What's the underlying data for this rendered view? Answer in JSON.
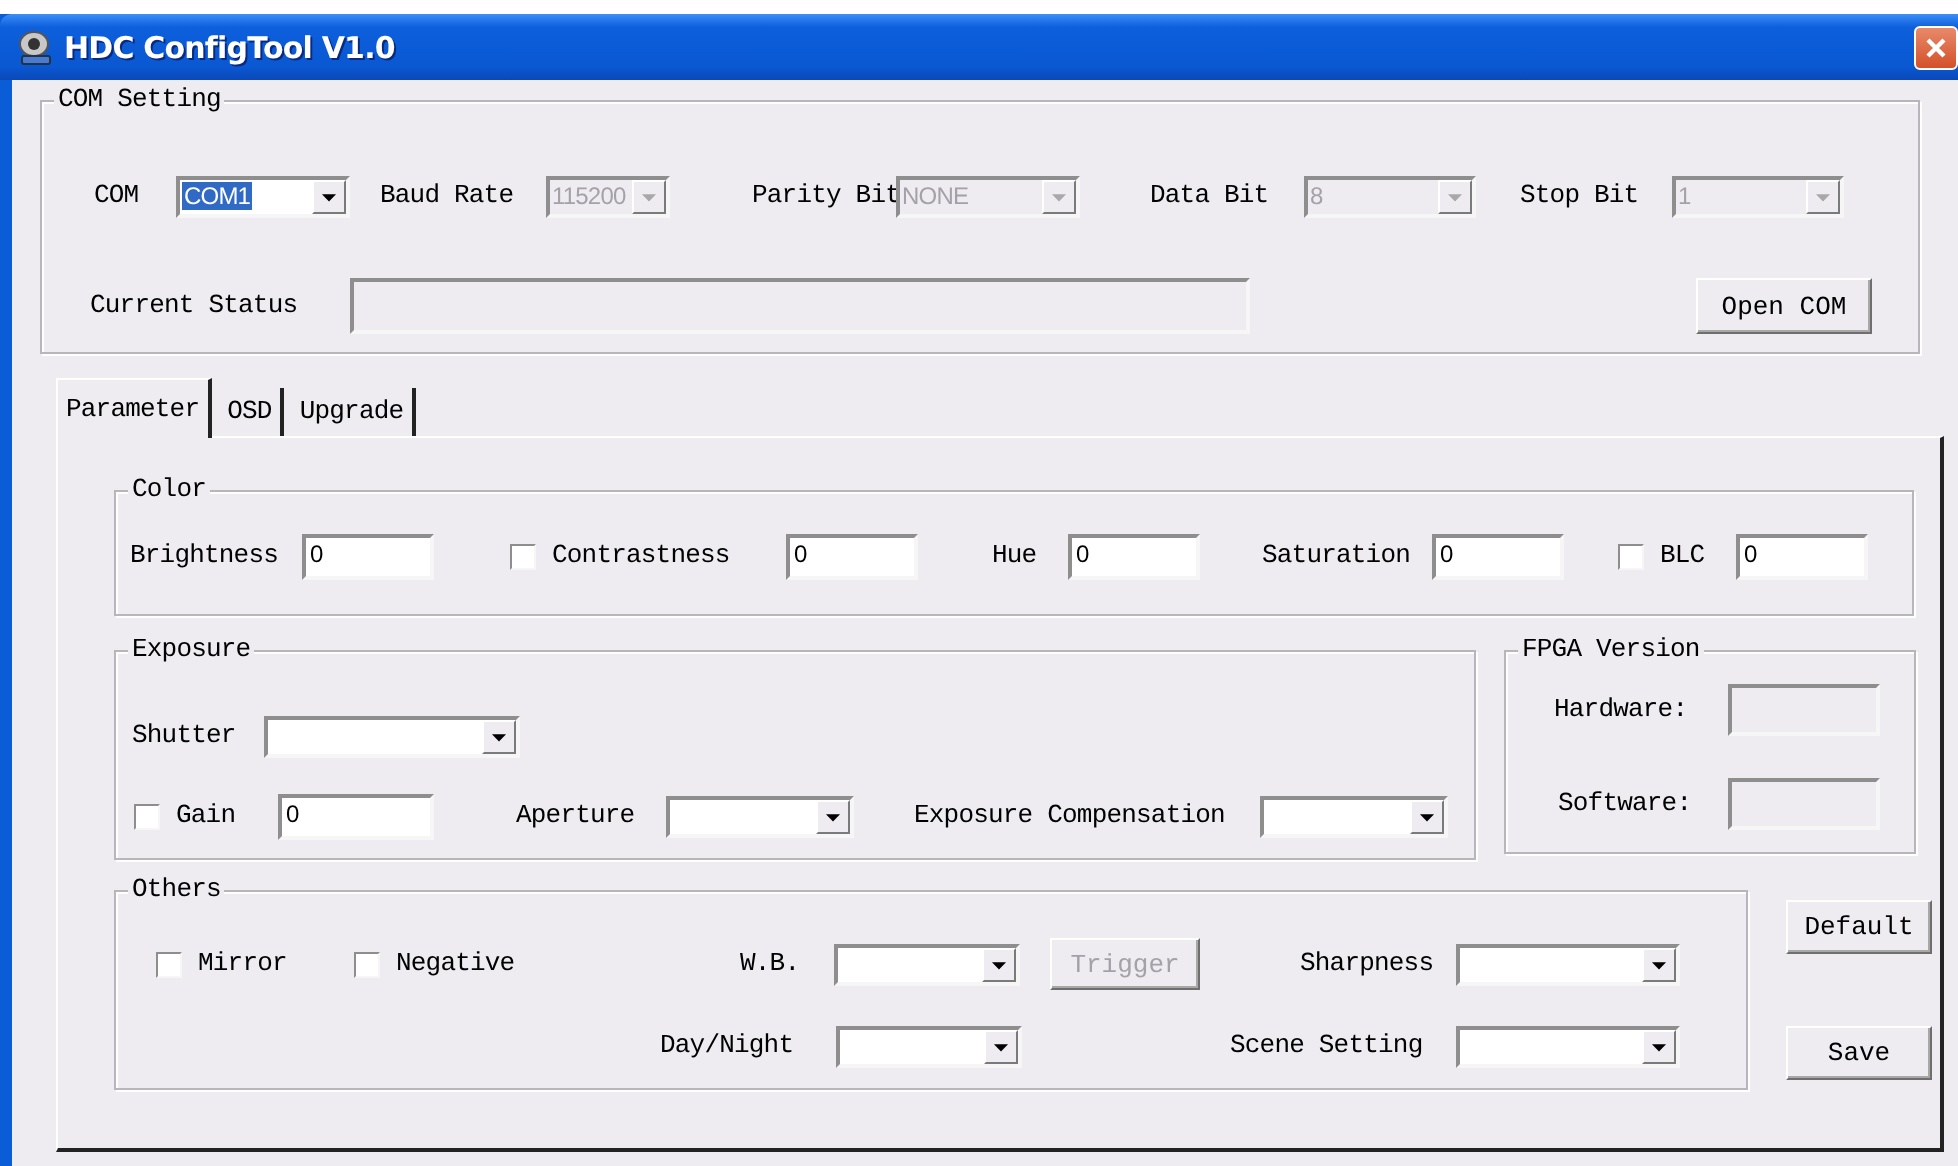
{
  "window": {
    "title": "HDC ConfigTool V1.0"
  },
  "com_setting": {
    "title": "COM Setting",
    "options": [
      {
        "label": "COM",
        "value": "COM1",
        "disabled": false,
        "highlighted": true
      },
      {
        "label": "Baud Rate",
        "value": "115200",
        "disabled": true,
        "highlighted": false
      },
      {
        "label": "Parity Bit",
        "value": "NONE",
        "disabled": true,
        "highlighted": false
      },
      {
        "label": "Data Bit",
        "value": "8",
        "disabled": true,
        "highlighted": false
      },
      {
        "label": "Stop Bit",
        "value": "1",
        "disabled": true,
        "highlighted": false
      }
    ],
    "status": {
      "label": "Current Status"
    },
    "open_button": {
      "label": "Open COM"
    }
  },
  "tabs": [
    {
      "label": "Parameter",
      "selected": true
    },
    {
      "label": "OSD",
      "selected": false
    },
    {
      "label": "Upgrade",
      "selected": false
    }
  ],
  "color": {
    "title": "Color",
    "items": [
      {
        "kind": "field",
        "label": "Brightness",
        "value": "0"
      },
      {
        "kind": "check-field",
        "label": "Contrastness",
        "checked": false,
        "value": "0"
      },
      {
        "kind": "field",
        "label": "Hue",
        "value": "0"
      },
      {
        "kind": "field",
        "label": "Saturation",
        "value": "0"
      },
      {
        "kind": "check-field",
        "label": "BLC",
        "checked": false,
        "value": "0"
      }
    ]
  },
  "exposure": {
    "title": "Exposure",
    "items": [
      {
        "kind": "combo",
        "label": "Shutter"
      },
      {
        "kind": "check-field",
        "label": "Gain",
        "checked": false,
        "value": "0"
      },
      {
        "kind": "combo",
        "label": "Aperture"
      },
      {
        "kind": "combo",
        "label": "Exposure Compensation"
      }
    ]
  },
  "fpga_version": {
    "title": "FPGA Version",
    "fields": [
      {
        "label": "Hardware:"
      },
      {
        "label": "Software:"
      }
    ]
  },
  "others": {
    "title": "Others",
    "items": [
      {
        "kind": "check",
        "label": "Mirror",
        "checked": false
      },
      {
        "kind": "check",
        "label": "Negative",
        "checked": false
      },
      {
        "kind": "combo",
        "label": "W.B."
      },
      {
        "kind": "button",
        "label": "Trigger",
        "disabled": true
      },
      {
        "kind": "combo",
        "label": "Sharpness"
      },
      {
        "kind": "combo",
        "label": "Day/Night"
      },
      {
        "kind": "combo",
        "label": "Scene Setting"
      }
    ]
  },
  "buttons": [
    {
      "label": "Default",
      "disabled": false
    },
    {
      "label": "Save",
      "disabled": false
    }
  ]
}
